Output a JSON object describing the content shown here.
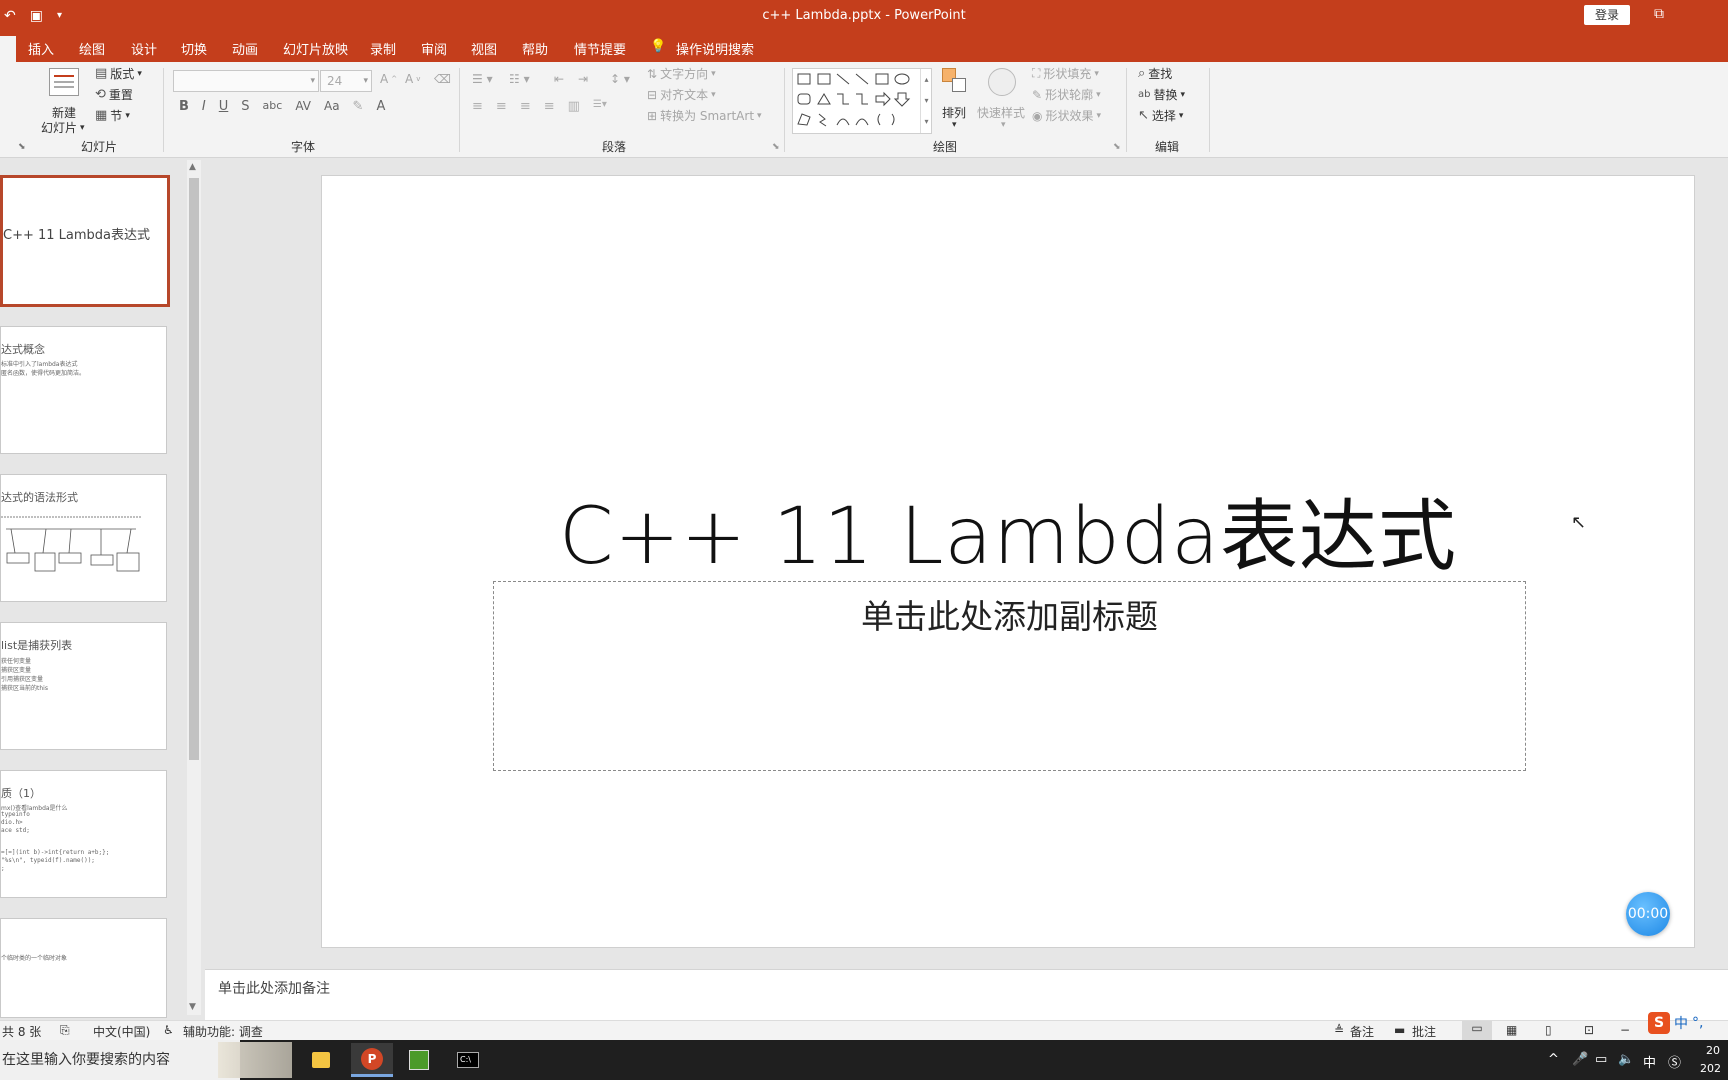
{
  "titlebar": {
    "doc_title": "c++ Lambda.pptx  -  PowerPoint",
    "login": "登录",
    "qat_icons": [
      "undo-icon",
      "slideshow-start-icon",
      "customize-icon"
    ]
  },
  "tabs": [
    "插入",
    "绘图",
    "设计",
    "切换",
    "动画",
    "幻灯片放映",
    "录制",
    "审阅",
    "视图",
    "帮助",
    "情节提要"
  ],
  "tell_me": "操作说明搜索",
  "ribbon": {
    "slides": {
      "label": "幻灯片",
      "new_slide_line1": "新建",
      "new_slide_line2": "幻灯片",
      "layout": "版式",
      "reset": "重置",
      "section": "节"
    },
    "font": {
      "label": "字体",
      "font_name": "",
      "font_size": "24",
      "bold": "B",
      "italic": "I",
      "underline": "U",
      "shadow": "S",
      "strike": "abc",
      "spacing": "AV",
      "case": "Aa",
      "color": "A"
    },
    "paragraph": {
      "label": "段落",
      "text_direction": "文字方向",
      "align_text": "对齐文本",
      "smartart": "转换为 SmartArt"
    },
    "drawing": {
      "label": "绘图",
      "arrange": "排列",
      "quick_styles": "快速样式",
      "shape_fill": "形状填充",
      "shape_outline": "形状轮廓",
      "shape_effects": "形状效果"
    },
    "editing": {
      "label": "编辑",
      "find": "查找",
      "replace": "替换",
      "select": "选择"
    }
  },
  "thumbnails": [
    {
      "title": "C++ 11 Lambda表达式",
      "lines": []
    },
    {
      "title": "达式概念",
      "lines": [
        "标准中引入了lambda表达式",
        "匿名函数，使得代码更加简洁。"
      ]
    },
    {
      "title": "达式的语法形式",
      "lines": []
    },
    {
      "title": "list是捕获列表",
      "lines": [
        "获任何变量",
        "捕获区变量",
        "引用捕获区变量",
        "捕获区当前的this"
      ]
    },
    {
      "title": "质（1）",
      "lines": [
        "mx()查看lambda是什么",
        "typeinfo",
        "dio.h>",
        "ace std;",
        "=[=](int b)->int{return a+b;};",
        "\"%s\\n\", typeid(f).name());",
        ";"
      ]
    },
    {
      "title": "",
      "lines": [
        "个临时类的一个临时对象"
      ]
    }
  ],
  "slide": {
    "title": "C++ 11 Lambda表达式",
    "subtitle_placeholder": "单击此处添加副标题",
    "timer": "00:00"
  },
  "notes_placeholder": "单击此处添加备注",
  "status": {
    "slide_count": "共 8 张",
    "language": "中文(中国)",
    "accessibility": "辅助功能: 调查",
    "notes": "备注",
    "comments": "批注"
  },
  "taskbar": {
    "search_placeholder": "在这里输入你要搜索的内容",
    "ime": "中",
    "clock_top": "20",
    "clock_bottom": "202"
  },
  "colors": {
    "brand": "#c43e1c",
    "active_thumb_border": "#b7472a",
    "timer": "#1e88e5"
  }
}
